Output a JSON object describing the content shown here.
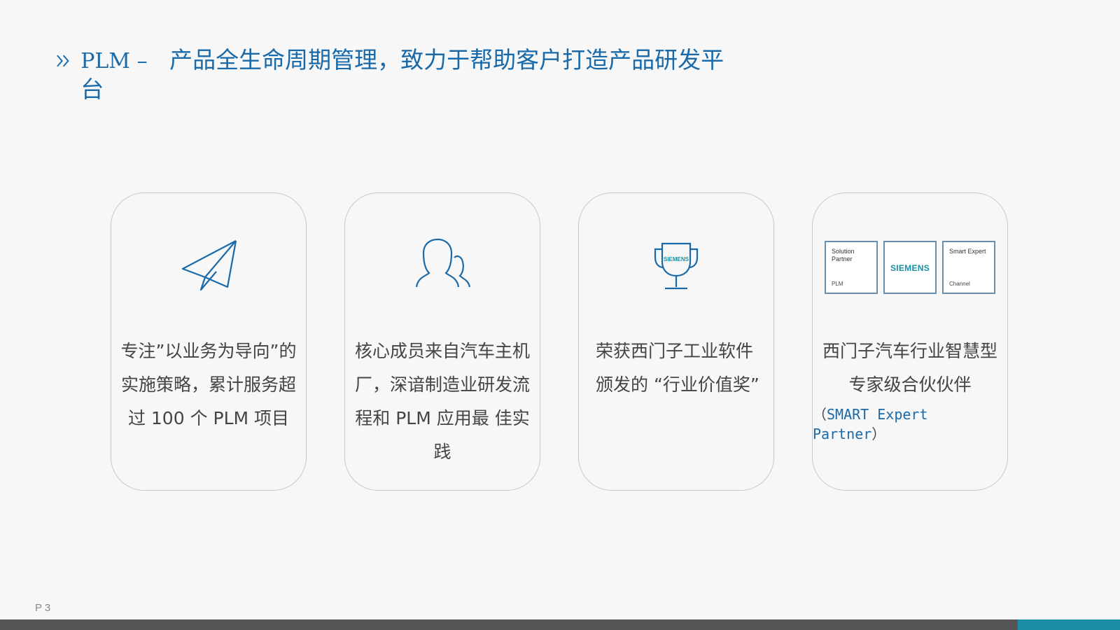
{
  "header": {
    "title_en": "PLM –",
    "title_cn": "产品全生命周期管理，致力于帮助客户打造产品研发平台"
  },
  "cards": [
    {
      "icon": "paper-plane-icon",
      "text": "专注”以业务为导向”的 实施策略，累计服务超 过 100 个 PLM 项目"
    },
    {
      "icon": "people-icon",
      "text": "核心成员来自汽车主机厂，深谙制造业研发流程和 PLM 应用最 佳实践"
    },
    {
      "icon": "trophy-icon",
      "trophy_label": "SIEMENS",
      "text": "荣获西门子工业软件颁发的 “行业价值奖”"
    },
    {
      "icon": "partner-badges-icon",
      "badges": [
        {
          "top": "Solution Partner",
          "bottom": "PLM"
        },
        {
          "center": "SIEMENS"
        },
        {
          "top": "Smart Expert",
          "bottom": "Channel"
        }
      ],
      "text": "西门子汽车行业智慧型专家级合伙伙伴",
      "sub_open": "（",
      "sub_text": "SMART Expert Partner",
      "sub_close": "）"
    }
  ],
  "footer": {
    "page": "P 3"
  },
  "colors": {
    "accent": "#1a6aa9",
    "teal": "#1a8fa6",
    "bar": "#555555"
  }
}
